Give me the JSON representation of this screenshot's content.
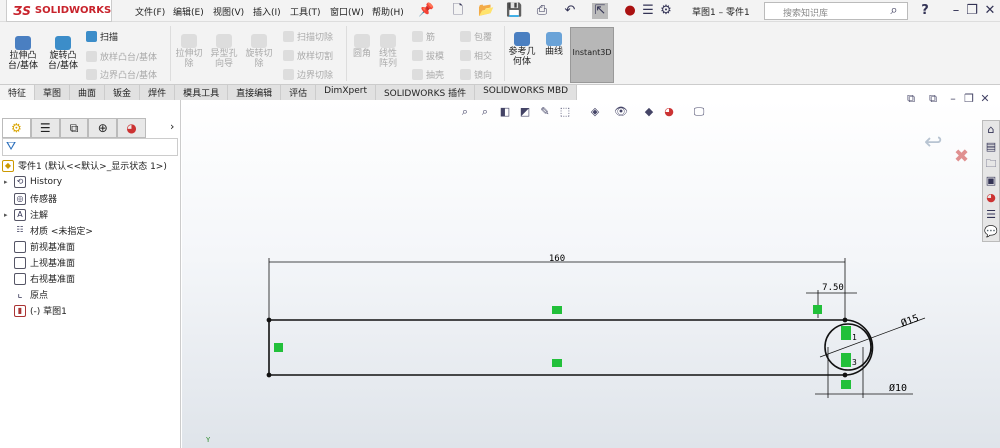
{
  "app": {
    "logo": "SOLIDWORKS",
    "doc_title": "草图1 – 零件1"
  },
  "menu": [
    "文件(F)",
    "编辑(E)",
    "视图(V)",
    "插入(I)",
    "工具(T)",
    "窗口(W)",
    "帮助(H)"
  ],
  "search": {
    "placeholder": "搜索知识库"
  },
  "ribbon": {
    "extrude_boss": "拉伸凸台/基体",
    "revolve_boss": "旋转凸台/基体",
    "sweep": "扫描",
    "loft_boss": "放样凸台/基体",
    "boundary_boss": "边界凸台/基体",
    "extrude_cut": "拉伸切除",
    "hole_wizard": "异型孔向导",
    "revolve_cut": "旋转切除",
    "sweep_cut": "扫描切除",
    "loft_cut": "放样切割",
    "boundary_cut": "边界切除",
    "fillet": "圆角",
    "linear_pattern": "线性阵列",
    "rib": "筋",
    "draft": "拔模",
    "shell": "抽壳",
    "wrap": "包覆",
    "intersect": "相交",
    "mirror": "镜向",
    "ref_geometry": "参考几何体",
    "curves": "曲线",
    "instant3d": "Instant3D"
  },
  "tabs": [
    "特征",
    "草图",
    "曲面",
    "钣金",
    "焊件",
    "模具工具",
    "直接编辑",
    "评估",
    "DimXpert",
    "SOLIDWORKS 插件",
    "SOLIDWORKS MBD"
  ],
  "tree": {
    "root": "零件1  (默认<<默认>_显示状态 1>)",
    "items": [
      "History",
      "传感器",
      "注解",
      "材质 <未指定>",
      "前视基准面",
      "上视基准面",
      "右视基准面",
      "原点",
      "(-) 草图1"
    ]
  },
  "sketch": {
    "dim_length": "160",
    "dim_offset": "7.50",
    "dim_dia_outer": "Ø15",
    "dim_dia_inner": "Ø10",
    "relation_labels": [
      "1",
      "3"
    ]
  },
  "colors": {
    "relation": "#22c03a",
    "logo": "#c8232c",
    "accent": "#2a6ebb"
  }
}
